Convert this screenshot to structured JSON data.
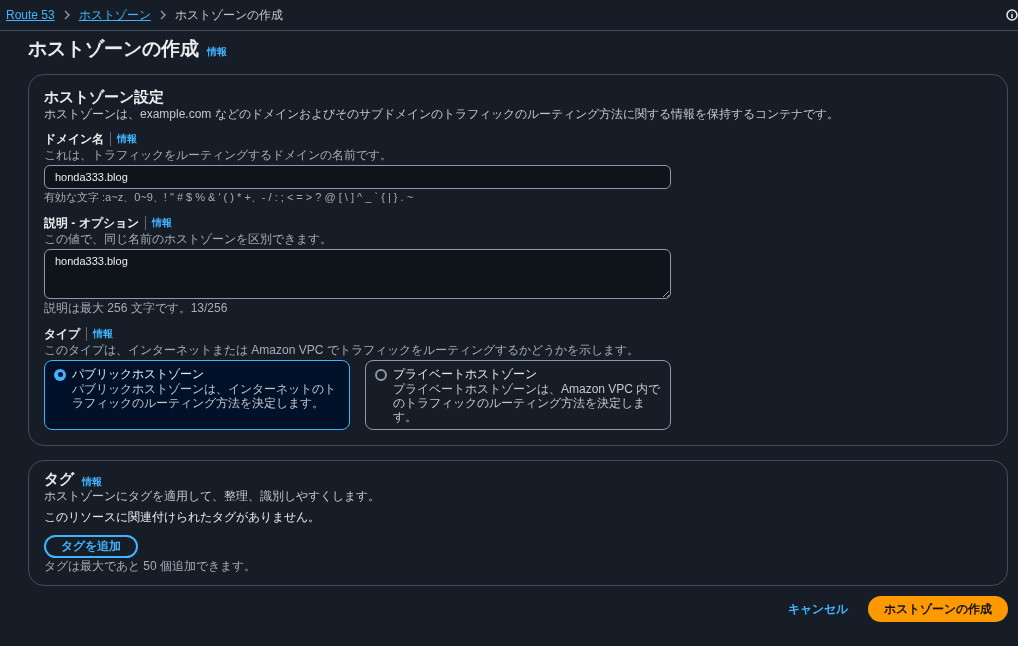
{
  "breadcrumbs": [
    {
      "label": "Route 53",
      "link": true
    },
    {
      "label": "ホストゾーン",
      "link": true
    },
    {
      "label": "ホストゾーンの作成",
      "link": false
    }
  ],
  "page_title": "ホストゾーンの作成",
  "page_info": "情報",
  "settings": {
    "title": "ホストゾーン設定",
    "description": "ホストゾーンは、example.com などのドメインおよびそのサブドメインのトラフィックのルーティング方法に関する情報を保持するコンテナです。",
    "domain": {
      "label": "ドメイン名",
      "info": "情報",
      "hint": "これは、トラフィックをルーティングするドメインの名前です。",
      "value": "honda333.blog",
      "constraint": "有効な文字 :a~z、0~9、! \" # $ % & ' ( ) * +、- / : ; < = > ? @ [ \\ ] ^ _ ` { | } . ~"
    },
    "comment": {
      "label": "説明 - オプション",
      "info": "情報",
      "hint": "この値で、同じ名前のホストゾーンを区別できます。",
      "value": "honda333.blog",
      "constraint": "説明は最大 256 文字です。13/256"
    },
    "type": {
      "label": "タイプ",
      "info": "情報",
      "hint": "このタイプは、インターネットまたは Amazon VPC でトラフィックをルーティングするかどうかを示します。",
      "options": [
        {
          "title": "パブリックホストゾーン",
          "description": "パブリックホストゾーンは、インターネットのトラフィックのルーティング方法を決定します。",
          "selected": true
        },
        {
          "title": "プライベートホストゾーン",
          "description": "プライベートホストゾーンは、Amazon VPC 内でのトラフィックのルーティング方法を決定します。",
          "selected": false
        }
      ]
    }
  },
  "tags": {
    "title": "タグ",
    "info": "情報",
    "description": "ホストゾーンにタグを適用して、整理、識別しやすくします。",
    "empty": "このリソースに関連付けられたタグがありません。",
    "add_button": "タグを追加",
    "limit": "タグは最大であと 50 個追加できます。"
  },
  "footer": {
    "cancel": "キャンセル",
    "submit": "ホストゾーンの作成"
  }
}
